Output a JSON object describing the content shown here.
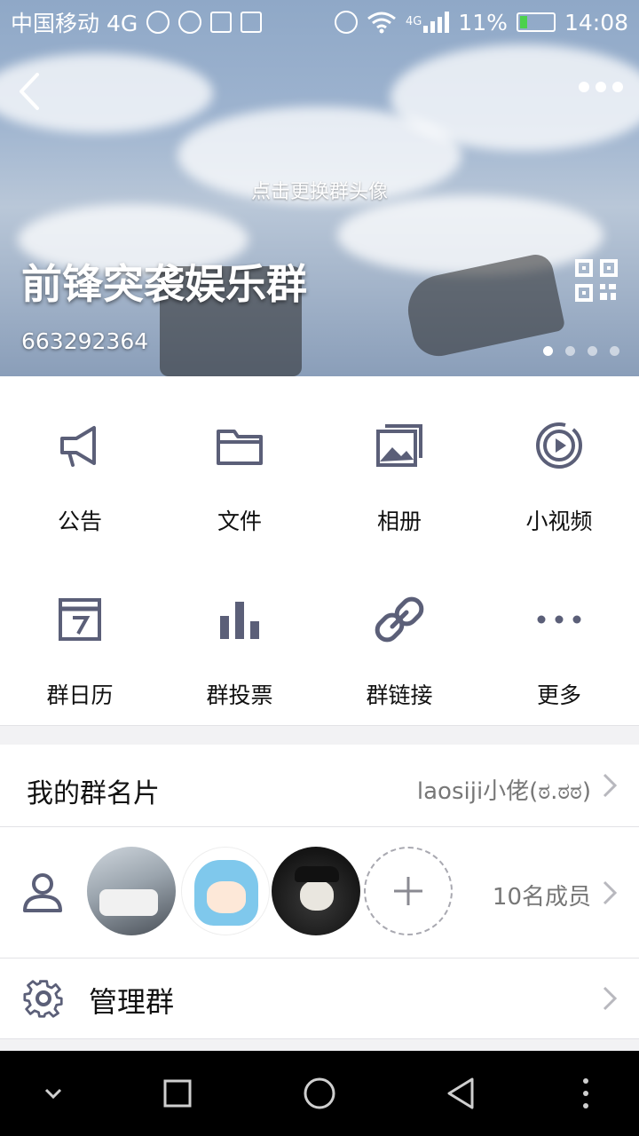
{
  "status_bar": {
    "carrier": "中国移动 4G",
    "network_badge": "4G",
    "battery": "11%",
    "time": "14:08"
  },
  "header": {
    "change_avatar_hint": "点击更换群头像",
    "group_name": "前锋突袭娱乐群",
    "group_id": "663292364",
    "pager_total": 4,
    "pager_active": 1
  },
  "features": [
    {
      "label": "公告",
      "icon": "megaphone-icon"
    },
    {
      "label": "文件",
      "icon": "folder-icon"
    },
    {
      "label": "相册",
      "icon": "photo-album-icon"
    },
    {
      "label": "小视频",
      "icon": "video-icon"
    },
    {
      "label": "群日历",
      "icon": "calendar-icon"
    },
    {
      "label": "群投票",
      "icon": "poll-icon"
    },
    {
      "label": "群链接",
      "icon": "link-icon"
    },
    {
      "label": "更多",
      "icon": "more-icon"
    }
  ],
  "group_card": {
    "label": "我的群名片",
    "value": "laosiji小佬(ಠ.ಠಠ)"
  },
  "members": {
    "count_text": "10名成员"
  },
  "manage": {
    "label": "管理群"
  },
  "colors": {
    "icon": "#5b5f78",
    "value_text": "#777777",
    "divider": "#e2e2e6"
  }
}
